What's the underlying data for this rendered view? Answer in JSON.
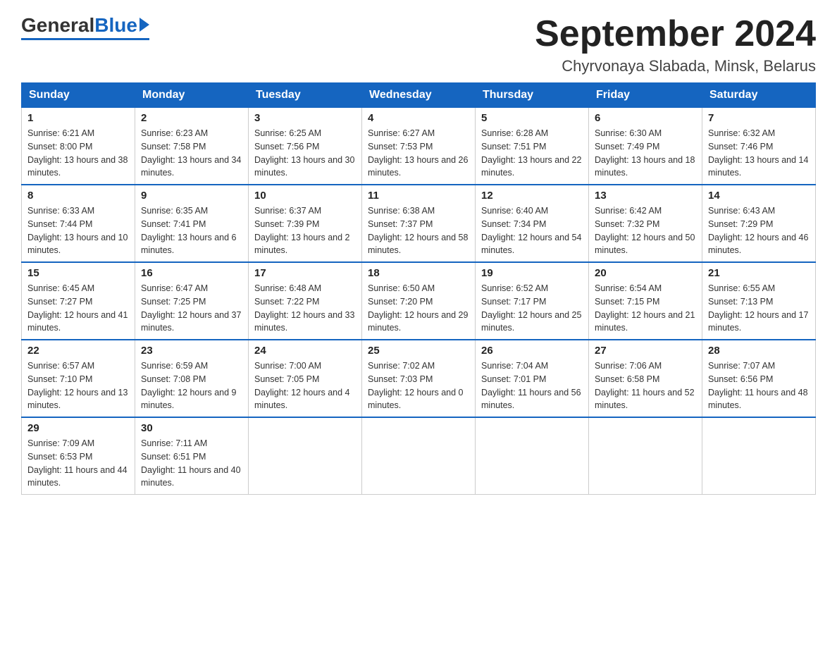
{
  "header": {
    "logo": {
      "general": "General",
      "blue": "Blue"
    },
    "title": "September 2024",
    "subtitle": "Chyrvonaya Slabada, Minsk, Belarus"
  },
  "weekdays": [
    "Sunday",
    "Monday",
    "Tuesday",
    "Wednesday",
    "Thursday",
    "Friday",
    "Saturday"
  ],
  "weeks": [
    [
      {
        "day": "1",
        "sunrise": "Sunrise: 6:21 AM",
        "sunset": "Sunset: 8:00 PM",
        "daylight": "Daylight: 13 hours and 38 minutes."
      },
      {
        "day": "2",
        "sunrise": "Sunrise: 6:23 AM",
        "sunset": "Sunset: 7:58 PM",
        "daylight": "Daylight: 13 hours and 34 minutes."
      },
      {
        "day": "3",
        "sunrise": "Sunrise: 6:25 AM",
        "sunset": "Sunset: 7:56 PM",
        "daylight": "Daylight: 13 hours and 30 minutes."
      },
      {
        "day": "4",
        "sunrise": "Sunrise: 6:27 AM",
        "sunset": "Sunset: 7:53 PM",
        "daylight": "Daylight: 13 hours and 26 minutes."
      },
      {
        "day": "5",
        "sunrise": "Sunrise: 6:28 AM",
        "sunset": "Sunset: 7:51 PM",
        "daylight": "Daylight: 13 hours and 22 minutes."
      },
      {
        "day": "6",
        "sunrise": "Sunrise: 6:30 AM",
        "sunset": "Sunset: 7:49 PM",
        "daylight": "Daylight: 13 hours and 18 minutes."
      },
      {
        "day": "7",
        "sunrise": "Sunrise: 6:32 AM",
        "sunset": "Sunset: 7:46 PM",
        "daylight": "Daylight: 13 hours and 14 minutes."
      }
    ],
    [
      {
        "day": "8",
        "sunrise": "Sunrise: 6:33 AM",
        "sunset": "Sunset: 7:44 PM",
        "daylight": "Daylight: 13 hours and 10 minutes."
      },
      {
        "day": "9",
        "sunrise": "Sunrise: 6:35 AM",
        "sunset": "Sunset: 7:41 PM",
        "daylight": "Daylight: 13 hours and 6 minutes."
      },
      {
        "day": "10",
        "sunrise": "Sunrise: 6:37 AM",
        "sunset": "Sunset: 7:39 PM",
        "daylight": "Daylight: 13 hours and 2 minutes."
      },
      {
        "day": "11",
        "sunrise": "Sunrise: 6:38 AM",
        "sunset": "Sunset: 7:37 PM",
        "daylight": "Daylight: 12 hours and 58 minutes."
      },
      {
        "day": "12",
        "sunrise": "Sunrise: 6:40 AM",
        "sunset": "Sunset: 7:34 PM",
        "daylight": "Daylight: 12 hours and 54 minutes."
      },
      {
        "day": "13",
        "sunrise": "Sunrise: 6:42 AM",
        "sunset": "Sunset: 7:32 PM",
        "daylight": "Daylight: 12 hours and 50 minutes."
      },
      {
        "day": "14",
        "sunrise": "Sunrise: 6:43 AM",
        "sunset": "Sunset: 7:29 PM",
        "daylight": "Daylight: 12 hours and 46 minutes."
      }
    ],
    [
      {
        "day": "15",
        "sunrise": "Sunrise: 6:45 AM",
        "sunset": "Sunset: 7:27 PM",
        "daylight": "Daylight: 12 hours and 41 minutes."
      },
      {
        "day": "16",
        "sunrise": "Sunrise: 6:47 AM",
        "sunset": "Sunset: 7:25 PM",
        "daylight": "Daylight: 12 hours and 37 minutes."
      },
      {
        "day": "17",
        "sunrise": "Sunrise: 6:48 AM",
        "sunset": "Sunset: 7:22 PM",
        "daylight": "Daylight: 12 hours and 33 minutes."
      },
      {
        "day": "18",
        "sunrise": "Sunrise: 6:50 AM",
        "sunset": "Sunset: 7:20 PM",
        "daylight": "Daylight: 12 hours and 29 minutes."
      },
      {
        "day": "19",
        "sunrise": "Sunrise: 6:52 AM",
        "sunset": "Sunset: 7:17 PM",
        "daylight": "Daylight: 12 hours and 25 minutes."
      },
      {
        "day": "20",
        "sunrise": "Sunrise: 6:54 AM",
        "sunset": "Sunset: 7:15 PM",
        "daylight": "Daylight: 12 hours and 21 minutes."
      },
      {
        "day": "21",
        "sunrise": "Sunrise: 6:55 AM",
        "sunset": "Sunset: 7:13 PM",
        "daylight": "Daylight: 12 hours and 17 minutes."
      }
    ],
    [
      {
        "day": "22",
        "sunrise": "Sunrise: 6:57 AM",
        "sunset": "Sunset: 7:10 PM",
        "daylight": "Daylight: 12 hours and 13 minutes."
      },
      {
        "day": "23",
        "sunrise": "Sunrise: 6:59 AM",
        "sunset": "Sunset: 7:08 PM",
        "daylight": "Daylight: 12 hours and 9 minutes."
      },
      {
        "day": "24",
        "sunrise": "Sunrise: 7:00 AM",
        "sunset": "Sunset: 7:05 PM",
        "daylight": "Daylight: 12 hours and 4 minutes."
      },
      {
        "day": "25",
        "sunrise": "Sunrise: 7:02 AM",
        "sunset": "Sunset: 7:03 PM",
        "daylight": "Daylight: 12 hours and 0 minutes."
      },
      {
        "day": "26",
        "sunrise": "Sunrise: 7:04 AM",
        "sunset": "Sunset: 7:01 PM",
        "daylight": "Daylight: 11 hours and 56 minutes."
      },
      {
        "day": "27",
        "sunrise": "Sunrise: 7:06 AM",
        "sunset": "Sunset: 6:58 PM",
        "daylight": "Daylight: 11 hours and 52 minutes."
      },
      {
        "day": "28",
        "sunrise": "Sunrise: 7:07 AM",
        "sunset": "Sunset: 6:56 PM",
        "daylight": "Daylight: 11 hours and 48 minutes."
      }
    ],
    [
      {
        "day": "29",
        "sunrise": "Sunrise: 7:09 AM",
        "sunset": "Sunset: 6:53 PM",
        "daylight": "Daylight: 11 hours and 44 minutes."
      },
      {
        "day": "30",
        "sunrise": "Sunrise: 7:11 AM",
        "sunset": "Sunset: 6:51 PM",
        "daylight": "Daylight: 11 hours and 40 minutes."
      },
      null,
      null,
      null,
      null,
      null
    ]
  ]
}
